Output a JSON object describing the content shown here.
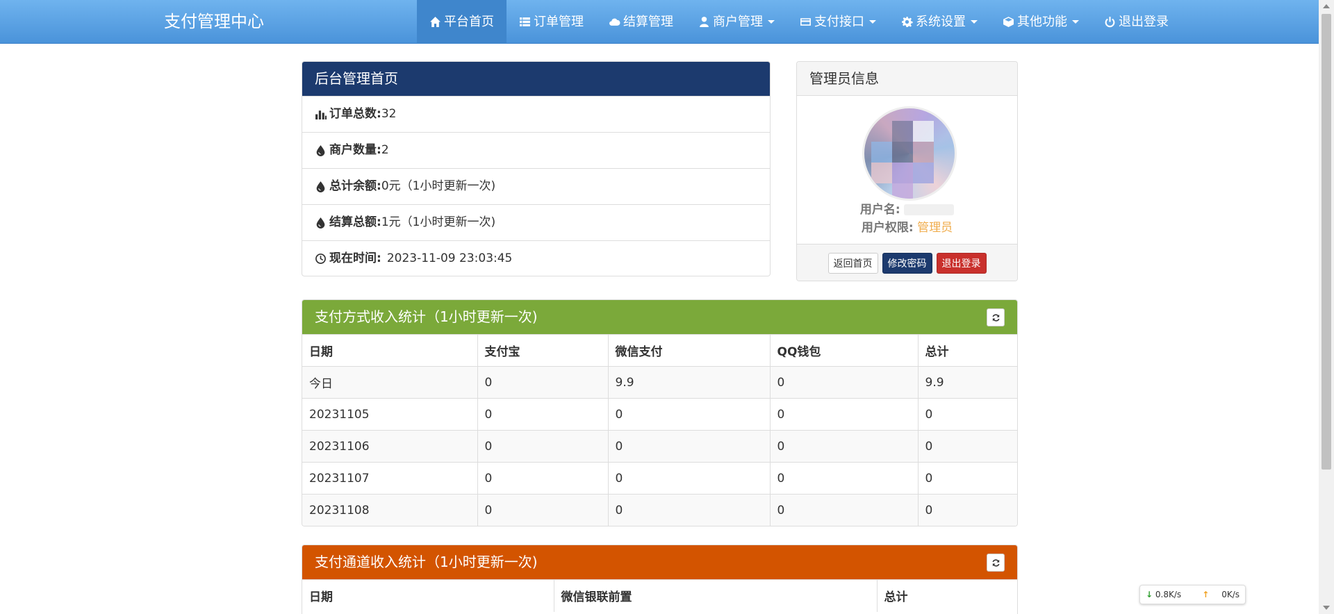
{
  "navbar": {
    "brand": "支付管理中心",
    "items": [
      {
        "label": "平台首页",
        "icon": "home-icon",
        "active": true,
        "dropdown": false
      },
      {
        "label": "订单管理",
        "icon": "list-icon",
        "active": false,
        "dropdown": false
      },
      {
        "label": "结算管理",
        "icon": "cloud-icon",
        "active": false,
        "dropdown": false
      },
      {
        "label": "商户管理",
        "icon": "user-icon",
        "active": false,
        "dropdown": true
      },
      {
        "label": "支付接口",
        "icon": "credit-card-icon",
        "active": false,
        "dropdown": true
      },
      {
        "label": "系统设置",
        "icon": "gear-icon",
        "active": false,
        "dropdown": true
      },
      {
        "label": "其他功能",
        "icon": "cube-icon",
        "active": false,
        "dropdown": true
      },
      {
        "label": "退出登录",
        "icon": "power-icon",
        "active": false,
        "dropdown": false
      }
    ]
  },
  "home": {
    "title": "后台管理首页",
    "rows": [
      {
        "icon": "bar-chart-icon",
        "label": "订单总数:",
        "value": "32"
      },
      {
        "icon": "drop-icon",
        "label": "商户数量:",
        "value": "2"
      },
      {
        "icon": "drop-icon",
        "label": "总计余额:",
        "value": "0元（1小时更新一次)"
      },
      {
        "icon": "drop-icon",
        "label": "结算总额:",
        "value": "1元（1小时更新一次)"
      },
      {
        "icon": "clock-icon",
        "label": "现在时间:",
        "value": "2023-11-09 23:03:45"
      }
    ]
  },
  "admin": {
    "title": "管理员信息",
    "username_label": "用户名:",
    "role_label": "用户权限:",
    "role_value": "管理员",
    "buttons": {
      "home": "返回首页",
      "password": "修改密码",
      "logout": "退出登录"
    }
  },
  "method_stats": {
    "title": "支付方式收入统计（1小时更新一次)",
    "headers": [
      "日期",
      "支付宝",
      "微信支付",
      "QQ钱包",
      "总计"
    ],
    "rows": [
      [
        "今日",
        "0",
        "9.9",
        "0",
        "9.9"
      ],
      [
        "20231105",
        "0",
        "0",
        "0",
        "0"
      ],
      [
        "20231106",
        "0",
        "0",
        "0",
        "0"
      ],
      [
        "20231107",
        "0",
        "0",
        "0",
        "0"
      ],
      [
        "20231108",
        "0",
        "0",
        "0",
        "0"
      ]
    ]
  },
  "channel_stats": {
    "title": "支付通道收入统计（1小时更新一次)",
    "headers": [
      "日期",
      "微信银联前置",
      "总计"
    ]
  },
  "netspeed": {
    "down": "0.8K/s",
    "up": "0K/s"
  },
  "colors": {
    "navbar": "#5aa3e6",
    "home_header": "#1c3a6e",
    "method_header": "#7ba93a",
    "channel_header": "#d35400",
    "role": "#f0ad4e"
  }
}
